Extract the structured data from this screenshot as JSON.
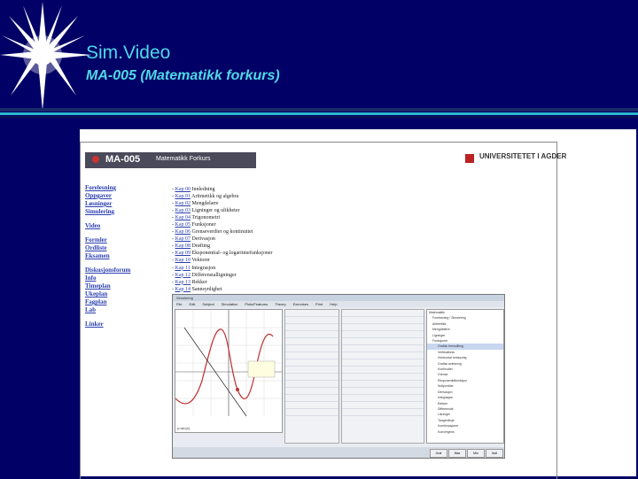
{
  "slide": {
    "title": "Sim.Video",
    "subtitle": "MA-005 (Matematikk forkurs)"
  },
  "colors": {
    "background": "#000066",
    "title": "#4fd8e6",
    "accent_rule": "#2ab7cf",
    "link": "#2a3fb0"
  },
  "screenshot": {
    "course_code": "MA-005",
    "course_name": "Matematikk Forkurs",
    "university": "UNIVERSITETET I AGDER",
    "nav": [
      "Forelesning",
      "Oppgaver",
      "Løsninger",
      "Simulering",
      "",
      "Video",
      "",
      "Formler",
      "Ordliste",
      "Eksamen",
      "",
      "Diskusjonsforum",
      "Info",
      "Timeplan",
      "Ukeplan",
      "Fagplan",
      "Lab",
      "",
      "Linker"
    ],
    "chapters": [
      {
        "link": "Kap 00",
        "text": "Innledning"
      },
      {
        "link": "Kap 01",
        "text": "Aritmetikk og algebra"
      },
      {
        "link": "Kap 02",
        "text": "Mengdelære"
      },
      {
        "link": "Kap 03",
        "text": "Ligninger og ulikheter"
      },
      {
        "link": "Kap 04",
        "text": "Trigonometri"
      },
      {
        "link": "Kap 05",
        "text": "Funksjoner"
      },
      {
        "link": "Kap 06",
        "text": "Grenseverdier og kontinuitet"
      },
      {
        "link": "Kap 07",
        "text": "Derivasjon"
      },
      {
        "link": "Kap 08",
        "text": "Drøfting"
      },
      {
        "link": "Kap 09",
        "text": "Eksponential- og logaritmefunksjoner"
      },
      {
        "link": "Kap 10",
        "text": "Vektorer"
      },
      {
        "link": "Kap 11",
        "text": "Integrasjon"
      },
      {
        "link": "Kap 12",
        "text": "Differensialligninger"
      },
      {
        "link": "Kap 13",
        "text": "Rekker"
      },
      {
        "link": "Kap 14",
        "text": "Sannsynlighet"
      }
    ],
    "app": {
      "title": "Simulering",
      "menu": [
        "File",
        "Edit",
        "Subject",
        "Simulation",
        "Plots/Features",
        "Theory",
        "Exercises",
        "Print",
        "Help"
      ],
      "plot_label": "y=sin(x)",
      "tree": [
        "Matematikk",
        "Forelesning / Simulering",
        "Aritmetikk",
        "Mengdelære",
        "Ligninger",
        "Funksjoner",
        "Grafisk fremstilling",
        "Vertikalforsk.",
        "Horisontal forskyving",
        "Grafisk avlesning",
        "Kontinuitet",
        "Grense",
        "Eksponentialfunksjon",
        "Nullpunkter",
        "Derivasjon",
        "Integrasjon",
        "Rekker",
        "Differensial",
        "Likninger",
        "Tangentlinje",
        "Kombinasjoner",
        "Konvergens"
      ],
      "status_buttons": [
        "Graf",
        "Max",
        "Min",
        "Null"
      ]
    }
  }
}
